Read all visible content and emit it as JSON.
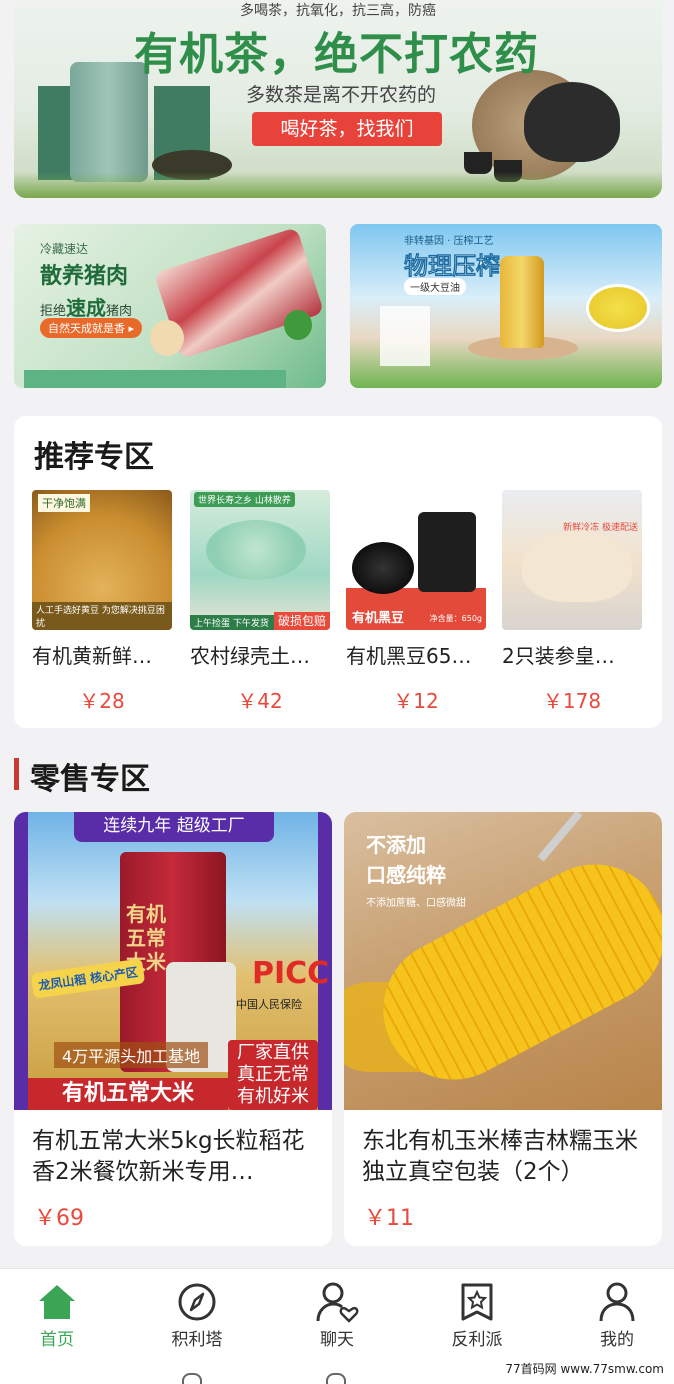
{
  "hero": {
    "topline": "多喝茶，抗氧化，抗三高，防癌",
    "headline": "有机茶，绝不打农药",
    "sub": "多数茶是离不开农药的",
    "button": "喝好茶，找我们"
  },
  "promos": {
    "pork": {
      "small": "冷藏速达",
      "title": "散养猪肉",
      "line_pre": "拒绝",
      "line_big": "速成",
      "line_post": "猪肉",
      "tag": "自然天成就是香 ▸"
    },
    "oil": {
      "chip": "非转基因 · 压榨工艺",
      "title": "物理压榨",
      "sub": "一级大豆油"
    }
  },
  "recommended": {
    "title": "推荐专区",
    "items": [
      {
        "name": "有机黄新鲜…",
        "price": "￥28",
        "badge": "干净饱满",
        "foot": "人工手选好黄豆  为您解决挑豆困扰"
      },
      {
        "name": "农村绿壳土…",
        "price": "￥42",
        "badge": "世界长寿之乡 山林散养",
        "foot": "上午捡蛋 下午发货",
        "tag": "破损包赔"
      },
      {
        "name": "有机黑豆65…",
        "price": "￥12",
        "label": "有机黑豆",
        "weight": "净含量：650g"
      },
      {
        "name": "2只装参皇…",
        "price": "￥178",
        "badge": "新鲜冷冻 极速配送"
      }
    ]
  },
  "retail": {
    "title": "零售专区",
    "items": [
      {
        "name": "有机五常大米5kg长粒稻花香2米餐饮新米专用…",
        "price": "￥69",
        "banner": "连续九年 超级工厂",
        "bag_text": "有机五常大米",
        "badge": "龙凤山稻 核心产区",
        "picc": "PICC",
        "picc_cn": "中国人民保险",
        "base": "4万平源头加工基地",
        "direct": "厂家直供 真正无常 有机好米",
        "bottom": "有机五常大米"
      },
      {
        "name": "东北有机玉米棒吉林糯玉米独立真空包装（2个）",
        "price": "￥11",
        "text1": "不添加",
        "text2": "口感纯粹",
        "small": "不添加蔗糖、口感微甜"
      }
    ]
  },
  "nav": [
    {
      "label": "首页",
      "icon": "home-icon",
      "active": true
    },
    {
      "label": "积利塔",
      "icon": "compass-icon",
      "active": false
    },
    {
      "label": "聊天",
      "icon": "chat-user-icon",
      "active": false
    },
    {
      "label": "反利派",
      "icon": "star-bookmark-icon",
      "active": false
    },
    {
      "label": "我的",
      "icon": "user-icon",
      "active": false
    }
  ],
  "watermark": "77首码网 www.77smw.com",
  "colors": {
    "accent": "#3aa655",
    "price": "#e84a3c",
    "section_bar": "#c8392f"
  }
}
